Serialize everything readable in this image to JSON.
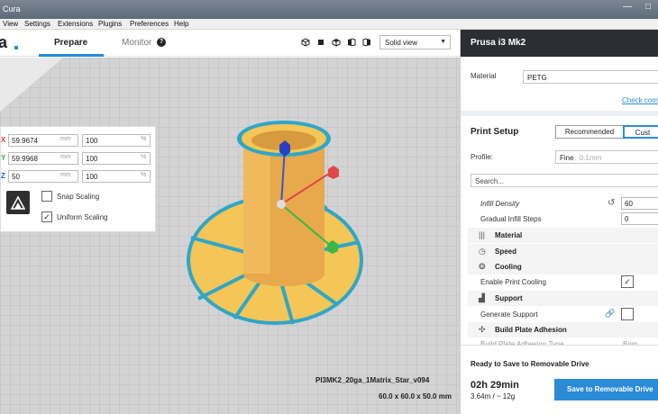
{
  "window": {
    "title": "Cura"
  },
  "menu": [
    "View",
    "Settings",
    "Extensions",
    "Plugins",
    "Preferences",
    "Help"
  ],
  "header": {
    "logo": "a",
    "tabs": [
      {
        "label": "Prepare",
        "active": true
      },
      {
        "label": "Monitor",
        "active": false
      }
    ],
    "view_select": "Solid view"
  },
  "transform": {
    "rows": [
      {
        "axis": "X",
        "axis_color": "#e04040",
        "value": "59.9674",
        "unit": "mm",
        "percent": "100",
        "pct_unit": "%"
      },
      {
        "axis": "Y",
        "axis_color": "#40a040",
        "value": "59.9968",
        "unit": "mm",
        "percent": "100",
        "pct_unit": "%"
      },
      {
        "axis": "Z",
        "axis_color": "#3050c0",
        "value": "50",
        "unit": "mm",
        "percent": "100",
        "pct_unit": "%"
      }
    ],
    "snap_scaling": {
      "label": "Snap Scaling",
      "checked": false
    },
    "uniform_scaling": {
      "label": "Uniform Scaling",
      "checked": true
    }
  },
  "right_panel": {
    "printer": "Prusa i3 Mk2",
    "material_label": "Material",
    "material_value": "PETG",
    "check_link": "Check com",
    "print_setup": "Print Setup",
    "mode_recommended": "Recommended",
    "mode_custom": "Cust",
    "profile_label": "Profile:",
    "profile_value": "Fine",
    "profile_hint": "0.1mm",
    "search_placeholder": "Search...",
    "settings": {
      "infill_density_label": "Infill Density",
      "infill_density_value": "60",
      "gradual_infill_label": "Gradual Infill Steps",
      "gradual_infill_value": "0",
      "cat_material": "Material",
      "cat_speed": "Speed",
      "cat_cooling": "Cooling",
      "enable_cooling_label": "Enable Print Cooling",
      "cat_support": "Support",
      "generate_support_label": "Generate Support",
      "cat_adhesion": "Build Plate Adhesion",
      "adhesion_type_partial": "Build Plate Adhesion Type",
      "adhesion_type_value_partial": "Brim"
    },
    "ready_text": "Ready to Save to Removable Drive",
    "print_time": "02h 29min",
    "material_usage": "3.64m / ~ 12g",
    "save_button": "Save to Removable Drive"
  },
  "viewport": {
    "object_name": "PI3MK2_20ga_1Matrix_Star_v094",
    "object_dims": "60.0 x 60.0 x 50.0 mm"
  }
}
